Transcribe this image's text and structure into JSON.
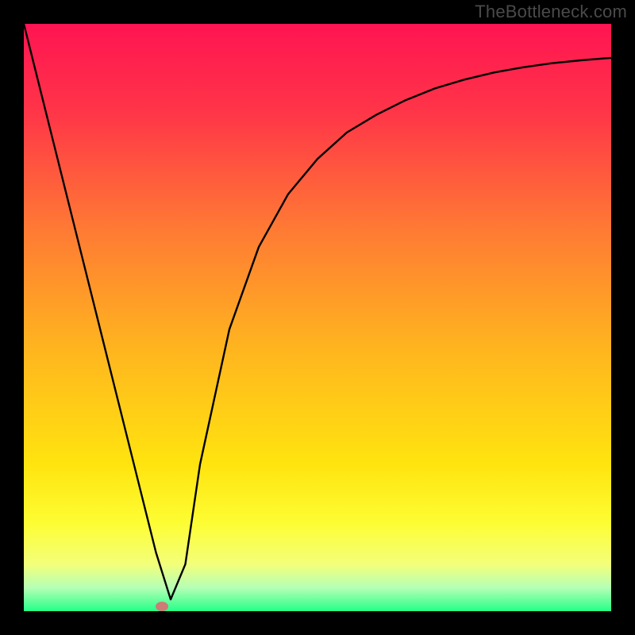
{
  "attribution": "TheBottleneck.com",
  "chart_data": {
    "type": "line",
    "title": "",
    "xlabel": "",
    "ylabel": "",
    "xlim": [
      0,
      100
    ],
    "ylim": [
      0,
      100
    ],
    "gradient_stops": [
      {
        "offset": 0,
        "color": "#ff1452"
      },
      {
        "offset": 15,
        "color": "#ff3548"
      },
      {
        "offset": 35,
        "color": "#ff7a34"
      },
      {
        "offset": 55,
        "color": "#ffb41f"
      },
      {
        "offset": 75,
        "color": "#ffe40f"
      },
      {
        "offset": 85,
        "color": "#fdfd33"
      },
      {
        "offset": 92,
        "color": "#f3ff7a"
      },
      {
        "offset": 96,
        "color": "#b6ffb6"
      },
      {
        "offset": 100,
        "color": "#25ff88"
      }
    ],
    "series": [
      {
        "name": "curve",
        "x": [
          0,
          5,
          10,
          15,
          20,
          22.5,
          25,
          27.5,
          30,
          35,
          40,
          45,
          50,
          55,
          60,
          65,
          70,
          75,
          80,
          85,
          90,
          95,
          100
        ],
        "y": [
          100,
          80,
          60,
          40,
          20,
          10,
          2,
          8,
          25,
          48,
          62,
          71,
          77,
          81.5,
          84.5,
          87,
          89,
          90.5,
          91.7,
          92.6,
          93.3,
          93.8,
          94.2
        ]
      }
    ],
    "marker": {
      "x": 23.5,
      "y": 0.8,
      "color": "#cd7b76"
    }
  }
}
